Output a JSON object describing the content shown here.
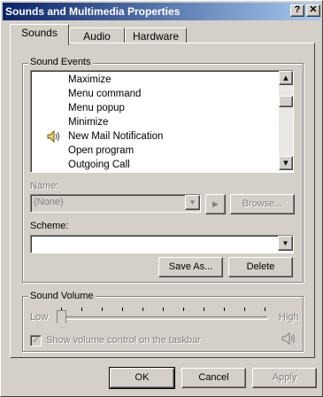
{
  "window": {
    "title": "Sounds and Multimedia Properties",
    "help_glyph": "?",
    "close_glyph": "✕"
  },
  "tabs": [
    {
      "label": "Sounds",
      "active": true
    },
    {
      "label": "Audio",
      "active": false
    },
    {
      "label": "Hardware",
      "active": false
    }
  ],
  "sound_events": {
    "group_label": "Sound Events",
    "items": [
      {
        "label": "Maximize",
        "has_sound": false
      },
      {
        "label": "Menu command",
        "has_sound": false
      },
      {
        "label": "Menu popup",
        "has_sound": false
      },
      {
        "label": "Minimize",
        "has_sound": false
      },
      {
        "label": "New Mail Notification",
        "has_sound": true
      },
      {
        "label": "Open program",
        "has_sound": false
      },
      {
        "label": "Outgoing Call",
        "has_sound": false
      }
    ]
  },
  "name": {
    "label": "Name:",
    "value": "(None)",
    "play_glyph": "▶",
    "browse_label": "Browse..."
  },
  "scheme": {
    "label": "Scheme:",
    "value": "",
    "save_as_label": "Save As...",
    "delete_label": "Delete"
  },
  "volume": {
    "group_label": "Sound Volume",
    "low_label": "Low",
    "high_label": "High",
    "level": 0.0,
    "checkbox_label": "Show volume control on the taskbar",
    "checkbox_checked": true,
    "checkbox_enabled": false
  },
  "footer": {
    "ok_label": "OK",
    "cancel_label": "Cancel",
    "apply_label": "Apply"
  },
  "colors": {
    "title_start": "#0a246a",
    "title_end": "#a6caf0",
    "face": "#d4d0c8",
    "disabled_text": "#808080"
  },
  "icons": [
    "help-icon",
    "close-icon",
    "speaker-icon",
    "scroll-up-icon",
    "scroll-down-icon",
    "dropdown-arrow-icon",
    "play-icon",
    "volume-icon"
  ]
}
